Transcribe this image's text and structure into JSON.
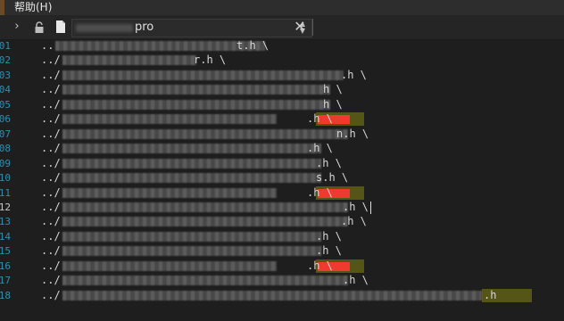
{
  "menubar": {
    "help_label": "帮助(H)"
  },
  "toolbar": {
    "file_name_suffix": "pro",
    "chevron_icon": "chevron-right-icon",
    "lock_icon": "lock-icon",
    "file_icon": "file-icon",
    "close_icon": "close-icon"
  },
  "editor": {
    "current_line": "12",
    "lines": [
      {
        "n": "01",
        "prefix": "..",
        "suffix": "t.h \\"
      },
      {
        "n": "02",
        "prefix": "../",
        "suffix": "r.h \\"
      },
      {
        "n": "03",
        "prefix": "../",
        "suffix": ".h \\"
      },
      {
        "n": "04",
        "prefix": "../",
        "suffix": "h \\"
      },
      {
        "n": "05",
        "prefix": "../",
        "suffix": "h \\"
      },
      {
        "n": "06",
        "prefix": "../",
        "suffix": ".h \\"
      },
      {
        "n": "07",
        "prefix": "../",
        "suffix": "n.h \\"
      },
      {
        "n": "08",
        "prefix": "../",
        "suffix": ".h \\"
      },
      {
        "n": "09",
        "prefix": "../",
        "suffix": ".h \\"
      },
      {
        "n": "10",
        "prefix": "../",
        "suffix": "s.h \\"
      },
      {
        "n": "11",
        "prefix": "../",
        "suffix": ".h \\"
      },
      {
        "n": "12",
        "prefix": "../",
        "suffix": ".h \\"
      },
      {
        "n": "13",
        "prefix": "../",
        "suffix": ".h \\"
      },
      {
        "n": "14",
        "prefix": "../",
        "suffix": ".h \\"
      },
      {
        "n": "15",
        "prefix": "../",
        "suffix": ".h \\"
      },
      {
        "n": "16",
        "prefix": "../",
        "suffix": ".h \\"
      },
      {
        "n": "17",
        "prefix": "../",
        "suffix": ".h \\"
      },
      {
        "n": "18",
        "prefix": "../",
        "suffix": ".h"
      }
    ]
  },
  "colors": {
    "background": "#1e1e1e",
    "line_number": "#2e8fb0",
    "find_highlight": "#5b5b16",
    "redaction_red": "#ef3b2f"
  }
}
